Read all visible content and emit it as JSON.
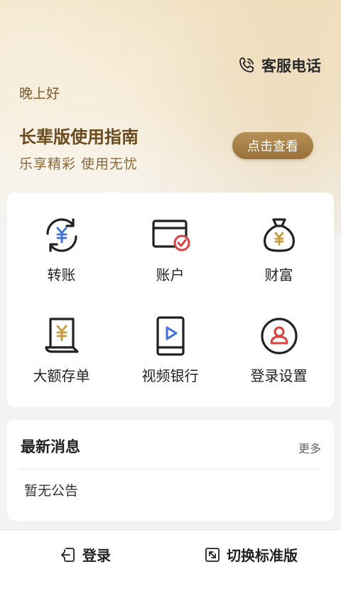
{
  "header": {
    "service_label": "客服电话",
    "greeting": "晚上好",
    "guide_title": "长辈版使用指南",
    "guide_subtitle": "乐享精彩  使用无忧",
    "view_button": "点击查看"
  },
  "grid": {
    "items": [
      {
        "label": "转账",
        "icon": "transfer-icon"
      },
      {
        "label": "账户",
        "icon": "account-card-icon"
      },
      {
        "label": "财富",
        "icon": "money-bag-icon"
      },
      {
        "label": "大额存单",
        "icon": "deposit-certificate-icon"
      },
      {
        "label": "视频银行",
        "icon": "video-bank-icon"
      },
      {
        "label": "登录设置",
        "icon": "login-settings-icon"
      }
    ]
  },
  "news": {
    "title": "最新消息",
    "more": "更多",
    "empty": "暂无公告"
  },
  "bottom": {
    "login": "登录",
    "switch": "切换标准版"
  },
  "colors": {
    "accent_gold": "#a67c45",
    "accent_blue": "#3f6fd8",
    "accent_red": "#d94040"
  }
}
